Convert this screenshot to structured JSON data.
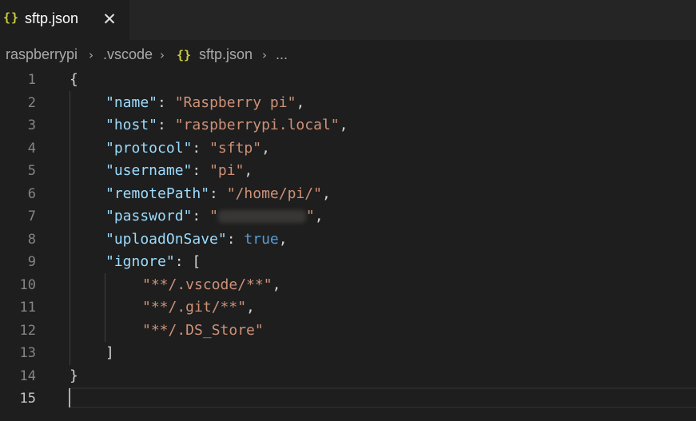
{
  "tab": {
    "icon": "{}",
    "title": "sftp.json",
    "close": "✕"
  },
  "breadcrumb": {
    "folder1": "raspberrypi",
    "folder2": ".vscode",
    "icon": "{}",
    "file": "sftp.json",
    "more": "...",
    "separator": "›"
  },
  "colors": {
    "key": "#9cdcfe",
    "string": "#ce9178",
    "boolean": "#569cd6",
    "punctuation": "#d4d4d4",
    "json_icon": "#cbcb41"
  },
  "lines": [
    {
      "n": "1",
      "open": "{"
    },
    {
      "n": "2",
      "key": "\"name\"",
      "sep": ": ",
      "value": "\"Raspberry pi\"",
      "end": ","
    },
    {
      "n": "3",
      "key": "\"host\"",
      "sep": ": ",
      "value": "\"raspberrypi.local\"",
      "end": ","
    },
    {
      "n": "4",
      "key": "\"protocol\"",
      "sep": ": ",
      "value": "\"sftp\"",
      "end": ","
    },
    {
      "n": "5",
      "key": "\"username\"",
      "sep": ": ",
      "value": "\"pi\"",
      "end": ","
    },
    {
      "n": "6",
      "key": "\"remotePath\"",
      "sep": ": ",
      "value": "\"/home/pi/\"",
      "end": ","
    },
    {
      "n": "7",
      "key": "\"password\"",
      "sep": ": ",
      "quote_open": "\"",
      "quote_close": "\"",
      "end": ","
    },
    {
      "n": "8",
      "key": "\"uploadOnSave\"",
      "sep": ": ",
      "value": "true",
      "end": ","
    },
    {
      "n": "9",
      "key": "\"ignore\"",
      "sep": ": ",
      "value": "["
    },
    {
      "n": "10",
      "value": "\"**/.vscode/**\"",
      "end": ","
    },
    {
      "n": "11",
      "value": "\"**/.git/**\"",
      "end": ","
    },
    {
      "n": "12",
      "value": "\"**/.DS_Store\""
    },
    {
      "n": "13",
      "value": "]"
    },
    {
      "n": "14",
      "value": "}"
    },
    {
      "n": "15"
    }
  ]
}
